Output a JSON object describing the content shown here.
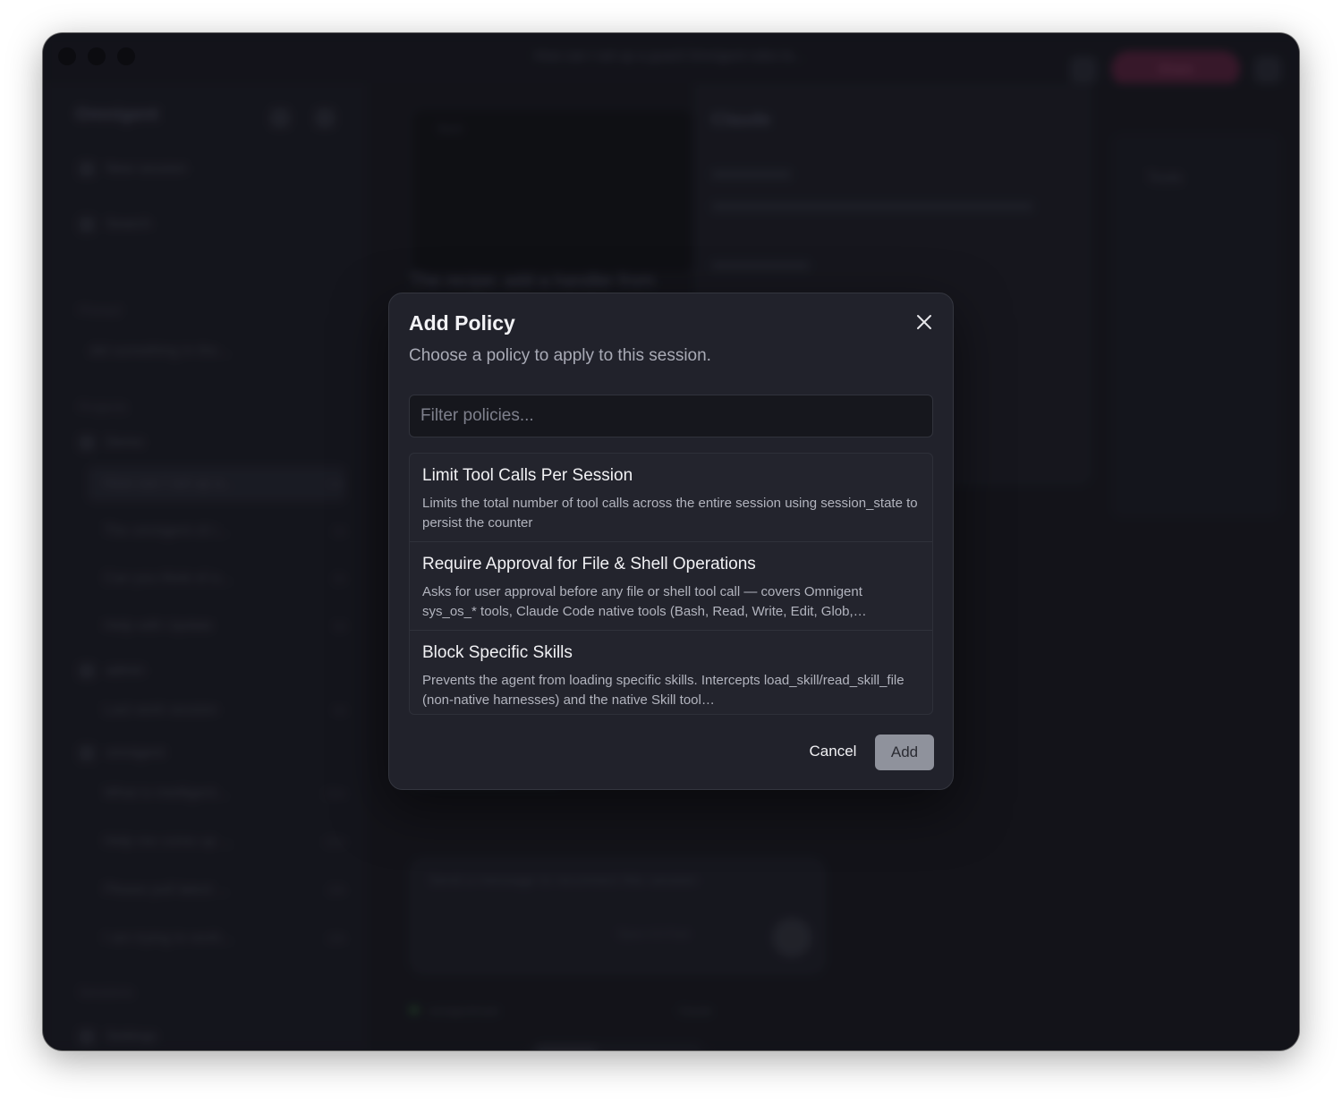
{
  "window": {
    "title": "How can I set up a guard Omnigent rules to..."
  },
  "background": {
    "brand": "Omnigent",
    "new_session": "New session",
    "search": "Search",
    "pinned_label": "Pinned",
    "pinned_item": "did something in the...",
    "projects_label": "Projects",
    "project_1": "Demo",
    "sessions_1": [
      {
        "label": "How can I set up a...",
        "count": "13m"
      },
      {
        "label": "The omnigent cli i...",
        "count": "1h"
      },
      {
        "label": "Can you think of a...",
        "count": "2h"
      },
      {
        "label": "Help with Update",
        "count": "3d"
      }
    ],
    "project_2": "admin",
    "sessions_2": [
      {
        "label": "Last work session",
        "count": "4d"
      }
    ],
    "project_3": "omnigent",
    "sessions_3": [
      {
        "label": "What is intelligent...",
        "count": "13m"
      },
      {
        "label": "Help me come up ...",
        "count": "13m"
      },
      {
        "label": "Please pull latest ...",
        "count": "19h"
      },
      {
        "label": "I am trying to work...",
        "count": "19h"
      }
    ],
    "sessions_label": "Sessions",
    "settings": "Settings",
    "code_label": "Bash",
    "message_head": "The recipe: add a handler from",
    "panel_title": "Claude",
    "right_panel_title": "Tools",
    "share_label": "Share",
    "composer_placeholder": "Send a message to reconnect this session",
    "model_label": "Opus 4.6 Fast",
    "status_left": "omnigent/main",
    "status_right": "Claude",
    "bottom_tab_1": "Chat",
    "bottom_tab_2": "Terminal"
  },
  "dialog": {
    "title": "Add Policy",
    "subtitle": "Choose a policy to apply to this session.",
    "filter_placeholder": "Filter policies...",
    "policies": [
      {
        "title": "Limit Tool Calls Per Session",
        "description": "Limits the total number of tool calls across the entire session using session_state to persist the counter"
      },
      {
        "title": "Require Approval for File & Shell Operations",
        "description": "Asks for user approval before any file or shell tool call — covers Omnigent sys_os_* tools, Claude Code native tools (Bash, Read, Write, Edit, Glob,…"
      },
      {
        "title": "Block Specific Skills",
        "description": "Prevents the agent from loading specific skills. Intercepts load_skill/read_skill_file (non-native harnesses) and the native Skill tool…"
      }
    ],
    "cancel_label": "Cancel",
    "add_label": "Add",
    "icons": {
      "close": "close-icon"
    }
  }
}
